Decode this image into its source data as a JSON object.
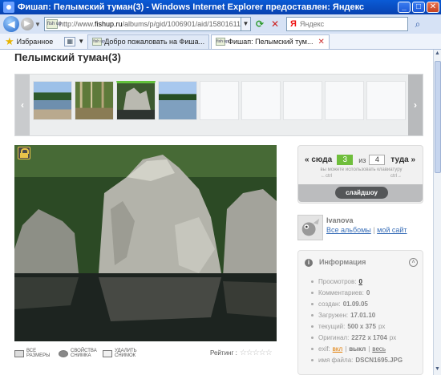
{
  "window": {
    "title": "Фишап: Пелымский туман(3) - Windows Internet Explorer предоставлен: Яндекс",
    "minimize": "_",
    "maximize": "□",
    "close": "✕"
  },
  "address": {
    "url_prefix": "http://www.",
    "url_domain": "fishup.ru",
    "url_path": "/albums/p/gid/1006901/aid/15801611/lid/50",
    "search_placeholder": "Яндекс",
    "search_logo": "Я"
  },
  "toolbar": {
    "favorites_label": "Избранное",
    "favicon_text": "fish up"
  },
  "tabs": [
    {
      "label": "Добро пожаловать на Фиша...",
      "active": false
    },
    {
      "label": "Фишап: Пелымский тум...",
      "active": true
    }
  ],
  "page": {
    "title": "Пелымский туман(3)"
  },
  "filmstrip": {
    "prev": "‹",
    "next": "›",
    "selected_index": 3
  },
  "nav": {
    "prev_label": "« сюда",
    "current": "3",
    "of_label": "из",
    "total": "4",
    "next_label": "туда »",
    "hint": "вы можете использовать клавиатуру",
    "hint_left": "←ctrl",
    "hint_right": "ctrl→",
    "slideshow_label": "слайдшоу"
  },
  "tools": [
    {
      "label": "все размеры",
      "icon": "sizes-icon"
    },
    {
      "label": "свойства снимка",
      "icon": "eye-icon"
    },
    {
      "label": "удалить снимок",
      "icon": "delete-icon"
    }
  ],
  "rating": {
    "label": "Рейтинг :",
    "stars": "☆☆☆☆☆"
  },
  "author": {
    "name": "Ivanova",
    "link_albums": "Все альбомы",
    "separator": "|",
    "link_site": "мой сайт"
  },
  "info": {
    "title": "Информация",
    "views_label": "Просмотров:",
    "views": "0",
    "comments_label": "Комментариев:",
    "comments": "0",
    "created_label": "создан:",
    "created": "01.09.05",
    "uploaded_label": "Загружен:",
    "uploaded": "17.01.10",
    "current_label": "текущий:",
    "current_size": "500 x 375",
    "unit": "px",
    "original_label": "Оригинал:",
    "original_size": "2272 x 1704",
    "exif_label": "exif:",
    "exif_on": "вкл",
    "exif_sep": "|",
    "exif_off": "выкл",
    "exif_all": "весь",
    "filename_label": "имя файла:",
    "filename": "DSCN1695.JPG"
  }
}
